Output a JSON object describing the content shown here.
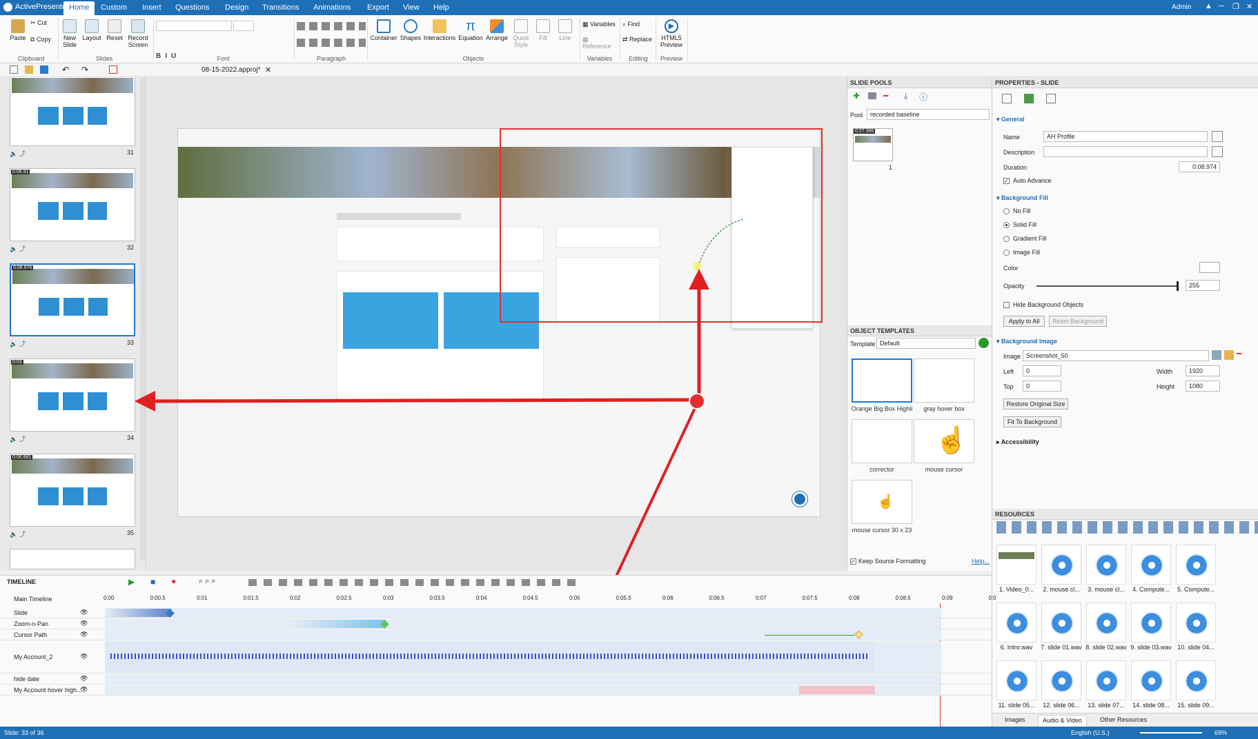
{
  "app": {
    "name": "ActivePresenter",
    "user": "Admin"
  },
  "ribbon_tabs": [
    "Home",
    "Custom",
    "Insert",
    "Questions",
    "Design",
    "Transitions",
    "Animations",
    "Export",
    "View",
    "Help"
  ],
  "ribbon": {
    "clipboard": {
      "paste": "Paste",
      "cut": "Cut",
      "copy": "Copy",
      "group": "Clipboard"
    },
    "slides": {
      "new_slide": "New Slide",
      "layout": "Layout",
      "reset": "Reset",
      "record_screen": "Record Screen",
      "group": "Slides"
    },
    "font_group": "Font",
    "paragraph_group": "Paragraph",
    "objects": {
      "container": "Container",
      "shapes": "Shapes",
      "interactions": "Interactions",
      "equation": "Equation",
      "arrange": "Arrange",
      "quick_style": "Quick Style",
      "fill": "Fill",
      "line": "Line",
      "group": "Objects"
    },
    "variables": {
      "variables": "Variables",
      "reference": "Reference",
      "group": "Variables"
    },
    "editing": {
      "find": "Find",
      "replace": "Replace",
      "group": "Editing"
    },
    "preview": {
      "html5": "HTML5 Preview",
      "group": "Preview"
    }
  },
  "document_tab": "08-15-2022.approj*",
  "slides": [
    {
      "num": "31",
      "duration": ""
    },
    {
      "num": "32",
      "duration": "0:06.91"
    },
    {
      "num": "33",
      "duration": "0:08.976"
    },
    {
      "num": "34",
      "duration": "0:03"
    },
    {
      "num": "35",
      "duration": "0:06.681"
    }
  ],
  "slide_pools": {
    "title": "SLIDE POOLS",
    "pool_label": "Pool",
    "pool_value": "recorded baseline",
    "thumb_duration": "0:27.366",
    "thumb_num": "1"
  },
  "object_templates": {
    "title": "OBJECT TEMPLATES",
    "template_label": "Template",
    "template_value": "Default",
    "items": [
      "Orange Big Box Highli",
      "gray hover box",
      "corrector",
      "mouse cursor",
      "mouse cursor 30 x 23"
    ],
    "keep_source": "Keep Source Formatting",
    "help": "Help..."
  },
  "properties": {
    "title": "PROPERTIES - SLIDE",
    "general": "General",
    "name_label": "Name",
    "name_value": "AH Profile",
    "description_label": "Description",
    "description_value": "",
    "duration_label": "Duration",
    "duration_value": "0:08.974",
    "auto_advance": "Auto Advance",
    "background_fill": "Background Fill",
    "no_fill": "No Fill",
    "solid_fill": "Solid Fill",
    "gradient_fill": "Gradient Fill",
    "image_fill": "Image Fill",
    "color_label": "Color",
    "opacity_label": "Opacity",
    "opacity_value": "255",
    "hide_bg": "Hide Background Objects",
    "apply_all": "Apply to All",
    "reset_bg": "Reset Background",
    "background_image": "Background Image",
    "image_label": "Image",
    "image_value": "Screenshot_50",
    "left_label": "Left",
    "left_value": "0",
    "top_label": "Top",
    "top_value": "0",
    "width_label": "Width",
    "width_value": "1920",
    "height_label": "Height",
    "height_value": "1080",
    "restore": "Restore Original Size",
    "fit": "Fit To Background",
    "accessibility": "Accessibility"
  },
  "resources": {
    "title": "RESOURCES",
    "items": [
      "1. Video_0...",
      "2. mouse cl...",
      "3. mouse cl...",
      "4. Compute...",
      "5. Compute...",
      "6. Intro.wav",
      "7. slide 01.wav",
      "8. slide 02.wav",
      "9. slide 03.wav",
      "10. slide 04...",
      "11. slide 05...",
      "12. slide 06...",
      "13. slide 07...",
      "14. slide 08...",
      "15. slide 09..."
    ],
    "tabs": [
      "Images",
      "Audio & Video",
      "Other Resources"
    ]
  },
  "timeline": {
    "title": "TIMELINE",
    "main": "Main Timeline",
    "ruler": [
      "0:00",
      "0:00.5",
      "0:01",
      "0:01.5",
      "0:02",
      "0:02.5",
      "0:03",
      "0:03.5",
      "0:04",
      "0:04.5",
      "0:05",
      "0:05.5",
      "0:06",
      "0:06.5",
      "0:07",
      "0:07.5",
      "0:08",
      "0:08.5",
      "0:09",
      "0:0"
    ],
    "tracks": [
      "Slide",
      "Zoom-n-Pan",
      "Cursor Path",
      "My Account_2",
      "hide date",
      "My Account hover high..."
    ]
  },
  "status": {
    "slide": "Slide: 33 of 36",
    "language": "English (U.S.)",
    "zoom": "69%"
  },
  "colors": {
    "accent": "#1e6fb6",
    "arrow": "#e02020",
    "selection": "#1e78d2"
  }
}
